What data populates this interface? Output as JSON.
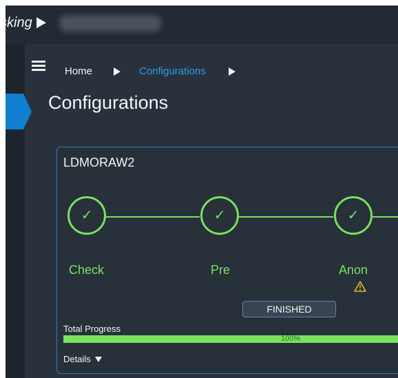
{
  "app": {
    "title": "sking"
  },
  "breadcrumb": {
    "items": [
      "Home",
      "Configurations"
    ]
  },
  "page": {
    "title": "Configurations"
  },
  "card": {
    "title": "LDMORAW2",
    "steps": [
      {
        "label": "Check",
        "icon": "check-icon",
        "status": "complete"
      },
      {
        "label": "Pre",
        "icon": "check-icon",
        "status": "complete"
      },
      {
        "label": "Anon",
        "icon": "check-icon",
        "status": "complete",
        "warning_icon": "warning-icon"
      }
    ],
    "check_mark": "✓",
    "status": "FINISHED",
    "progress": {
      "label": "Total Progress",
      "value": 100,
      "text": "100%"
    },
    "details_label": "Details"
  },
  "colors": {
    "accent_green": "#79e063",
    "accent_blue": "#2f79c0",
    "link_blue": "#2f9cf0",
    "warning": "#e8b92d",
    "background": "#262d37"
  }
}
